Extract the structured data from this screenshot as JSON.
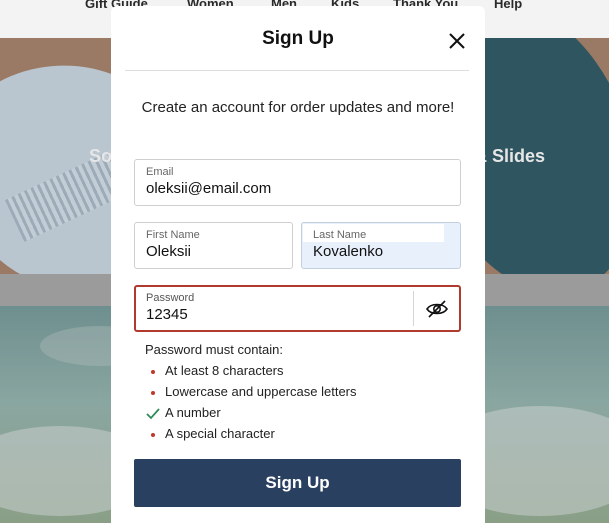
{
  "background": {
    "nav_items": [
      "Gift Guide",
      "Women",
      "Men",
      "Kids",
      "Thank You",
      "Help"
    ],
    "hero_text_left": "So",
    "hero_text_right": "& Slides"
  },
  "modal": {
    "title": "Sign Up",
    "intro": "Create an account for order updates and more!",
    "close_icon": "close-icon",
    "fields": {
      "email": {
        "label": "Email",
        "value": "oleksii@email.com"
      },
      "first_name": {
        "label": "First Name",
        "value": "Oleksii"
      },
      "last_name": {
        "label": "Last Name",
        "value": "Kovalenko"
      },
      "password": {
        "label": "Password",
        "value": "12345",
        "toggle_icon": "eye-slash-icon"
      }
    },
    "requirements": {
      "title": "Password must contain:",
      "items": [
        {
          "text": "At least 8 characters",
          "met": false
        },
        {
          "text": "Lowercase and uppercase letters",
          "met": false
        },
        {
          "text": "A number",
          "met": true
        },
        {
          "text": "A special character",
          "met": false
        }
      ]
    },
    "submit_label": "Sign Up"
  },
  "colors": {
    "primary": "#2a4061",
    "error": "#b03a2e",
    "success": "#2e8b57",
    "autofill": "#e8f0fb"
  }
}
